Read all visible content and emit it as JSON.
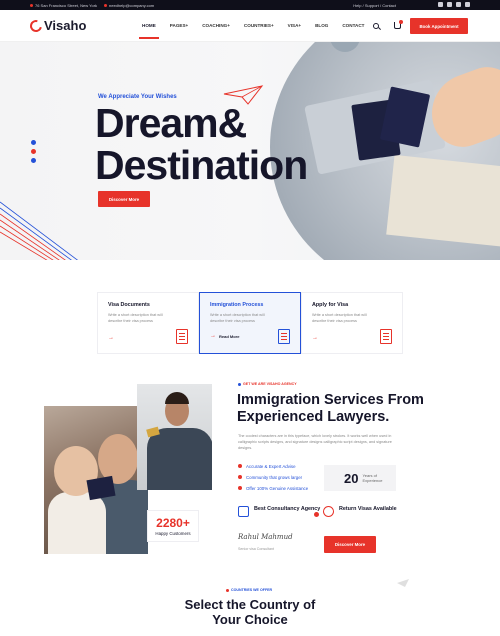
{
  "topbar": {
    "address": "76 San Francisco Street, New York",
    "email": "needhelp@company.com",
    "links": "Help / Support / Contact"
  },
  "header": {
    "logo": "Visaho",
    "nav": [
      "HOME",
      "PAGES+",
      "COACHING+",
      "COUNTRIES+",
      "VISA+",
      "BLOG",
      "CONTACT"
    ],
    "book_button": "Book Appointment"
  },
  "hero": {
    "tag": "We Appreciate Your Wishes",
    "title_line1": "Dream",
    "amp": "&",
    "title_line2": "Destination",
    "button": "Discover More"
  },
  "services": [
    {
      "title": "Visa Documents",
      "desc": "Write a short description that will describe their visa process"
    },
    {
      "title": "Immigration Process",
      "desc": "Write a short description that will describe their visa process",
      "more": "Read More"
    },
    {
      "title": "Apply for Visa",
      "desc": "Write a short description that will describe their visa process"
    }
  ],
  "about": {
    "tag": "GET WE ARE VISAHO AGENCY",
    "title_line1": "Immigration Services From",
    "title_line2": "Experienced Lawyers.",
    "text": "The coolest characters are in this typeface, which lovely strokes. It works well when used in calligraphic scripts designs, and signature designs calligraphic script designs, and signature designs.",
    "checks": [
      "Accurate & Expert Advise",
      "Community that grows larger",
      "Offer 100% Genuine Assistance"
    ],
    "years_num": "20",
    "years_label": "Years of Experience",
    "feat1": "Best Consultancy Agency",
    "feat2": "Return Visas Available",
    "signature": "Rahul Mahmud",
    "role": "Senior visa Consultant",
    "button": "Discover More",
    "customers_num": "2280+",
    "customers_label": "Happy Customers"
  },
  "countries": {
    "tag": "COUNTRIES WE OFFER",
    "title_line1": "Select the Country of",
    "title_line2": "Your Choice"
  },
  "colors": {
    "accent": "#e7332a",
    "blue": "#2451d8",
    "dark": "#16162a"
  }
}
